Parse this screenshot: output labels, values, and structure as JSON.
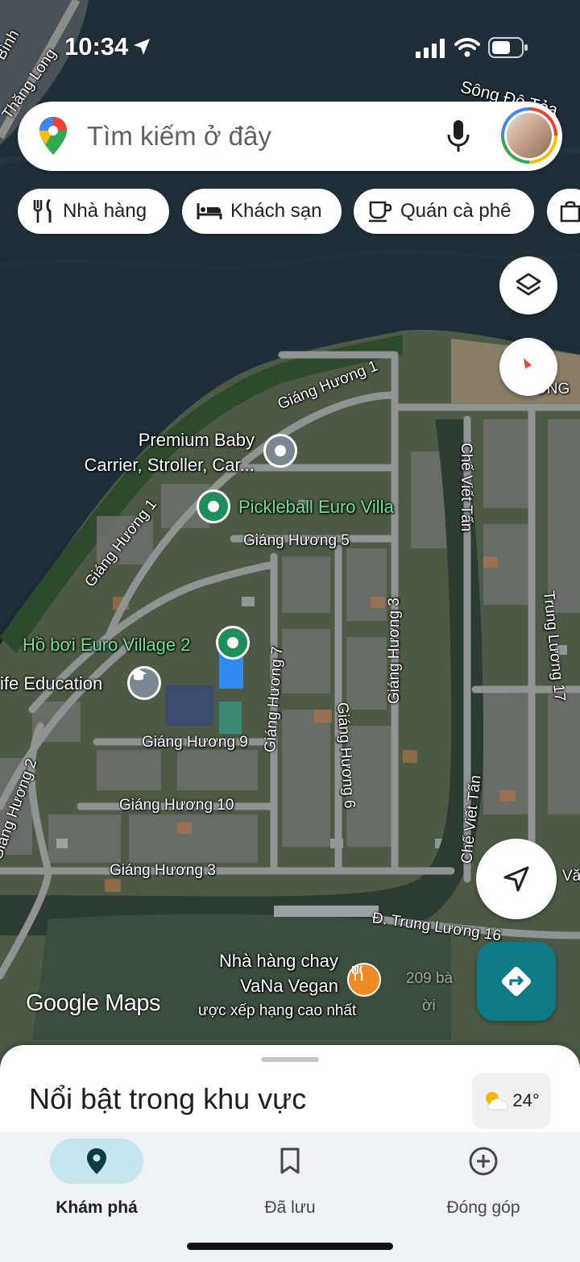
{
  "status_bar": {
    "time": "10:34"
  },
  "search": {
    "placeholder": "Tìm kiếm ở đây"
  },
  "chips": [
    {
      "label": "Nhà hàng",
      "icon": "restaurant-icon"
    },
    {
      "label": "Khách sạn",
      "icon": "hotel-bed-icon"
    },
    {
      "label": "Quán cà phê",
      "icon": "coffee-icon"
    },
    {
      "label": "",
      "icon": "shopping-bag-icon"
    }
  ],
  "map": {
    "streets": [
      "Giáng Hương 1",
      "Giáng Hương 1",
      "Giáng Hương 5",
      "Giáng Hương 3",
      "Giáng Hương 7",
      "Giáng Hương 6",
      "Giáng Hương 9",
      "Giáng Hương 10",
      "Giáng Hương 3",
      "Giáng Hương 2",
      "Chế Viết Tấn",
      "Chế Viết Tấn",
      "Trung Lương 17",
      "Đ. Trung Lương 16",
      "Thăng Long",
      "Bình",
      "Sông Đô Tỏa",
      "ONG",
      "Vă"
    ],
    "pois": {
      "premium_baby_line1": "Premium Baby",
      "premium_baby_line2": "Carrier, Stroller, Car...",
      "pickleball": "Pickleball Euro Villa",
      "pool": "Hồ bơi Euro Village 2",
      "education": "ife Education",
      "vegan_line1": "Nhà hàng chay",
      "vegan_line2": "VaNa Vegan",
      "vegan_line3": "ược xếp hạng cao nhất",
      "vegan_faint_1": "209 bà",
      "vegan_faint_2": "ời"
    },
    "watermark": "Google Maps"
  },
  "bottom_sheet": {
    "title": "Nổi bật trong khu vực",
    "temperature": "24°"
  },
  "nav": [
    {
      "label": "Khám phá",
      "icon": "location-pin-icon",
      "active": true
    },
    {
      "label": "Đã lưu",
      "icon": "bookmark-icon",
      "active": false
    },
    {
      "label": "Đóng góp",
      "icon": "add-circle-icon",
      "active": false
    }
  ],
  "colors": {
    "accent": "#0e7c86",
    "poi_green": "#1e8e5a",
    "poi_gray": "#7a8790",
    "nav_active_pill": "#c5e6ef",
    "restaurant_orange": "#f08a24"
  }
}
